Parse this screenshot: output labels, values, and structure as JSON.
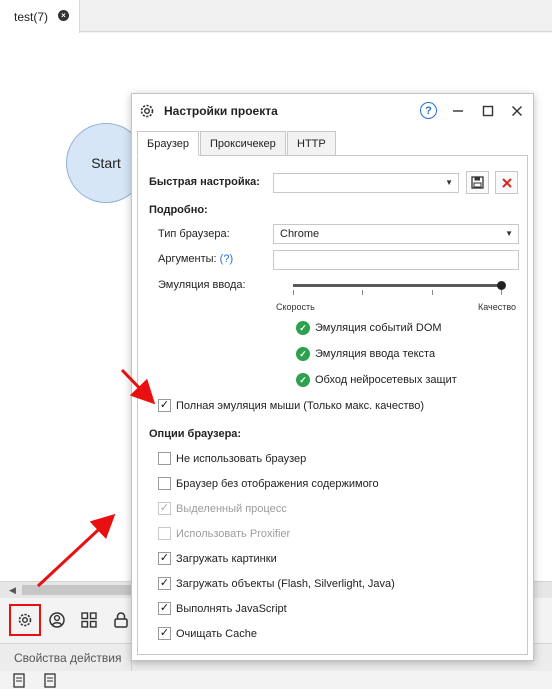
{
  "document_tab": {
    "title": "test(7)"
  },
  "canvas": {
    "start_node": "Start"
  },
  "bottom_panel": {
    "tab_label": "Свойства действия"
  },
  "dialog": {
    "title": "Настройки проекта",
    "help_label": "?",
    "tabs": [
      "Браузер",
      "Проксичекер",
      "HTTP"
    ],
    "quick_setup": {
      "label": "Быстрая настройка:",
      "value": ""
    },
    "detailed": {
      "heading": "Подробно:",
      "browser_type_label": "Тип браузера:",
      "browser_type_value": "Chrome",
      "arguments_label": "Аргументы:",
      "arguments_help": "(?)",
      "arguments_value": "",
      "input_emulation_label": "Эмуляция ввода:",
      "slider_left": "Скорость",
      "slider_right": "Качество",
      "slider_level": 1.0
    },
    "features": [
      "Эмуляция событий DOM",
      "Эмуляция ввода текста",
      "Обход нейросетевых защит"
    ],
    "full_mouse": {
      "label": "Полная эмуляция мыши (Только макс. качество)",
      "checked": true
    },
    "browser_options": {
      "heading": "Опции браузера:",
      "items": [
        {
          "label": "Не использовать браузер",
          "checked": false,
          "disabled": false
        },
        {
          "label": "Браузер без отображения содержимого",
          "checked": false,
          "disabled": false
        },
        {
          "label": "Выделенный процесс",
          "checked": true,
          "disabled": true
        },
        {
          "label": "Использовать Proxifier",
          "checked": false,
          "disabled": true
        },
        {
          "label": "Загружать картинки",
          "checked": true,
          "disabled": false
        },
        {
          "label": "Загружать объекты (Flash, Silverlight, Java)",
          "checked": true,
          "disabled": false
        },
        {
          "label": "Выполнять JavaScript",
          "checked": true,
          "disabled": false
        },
        {
          "label": "Очищать Cache",
          "checked": true,
          "disabled": false
        }
      ]
    }
  },
  "colors": {
    "accent": "#2a6fd6",
    "annotation": "#e81010",
    "check_green": "#2da24e"
  },
  "check_glyph": "✓"
}
